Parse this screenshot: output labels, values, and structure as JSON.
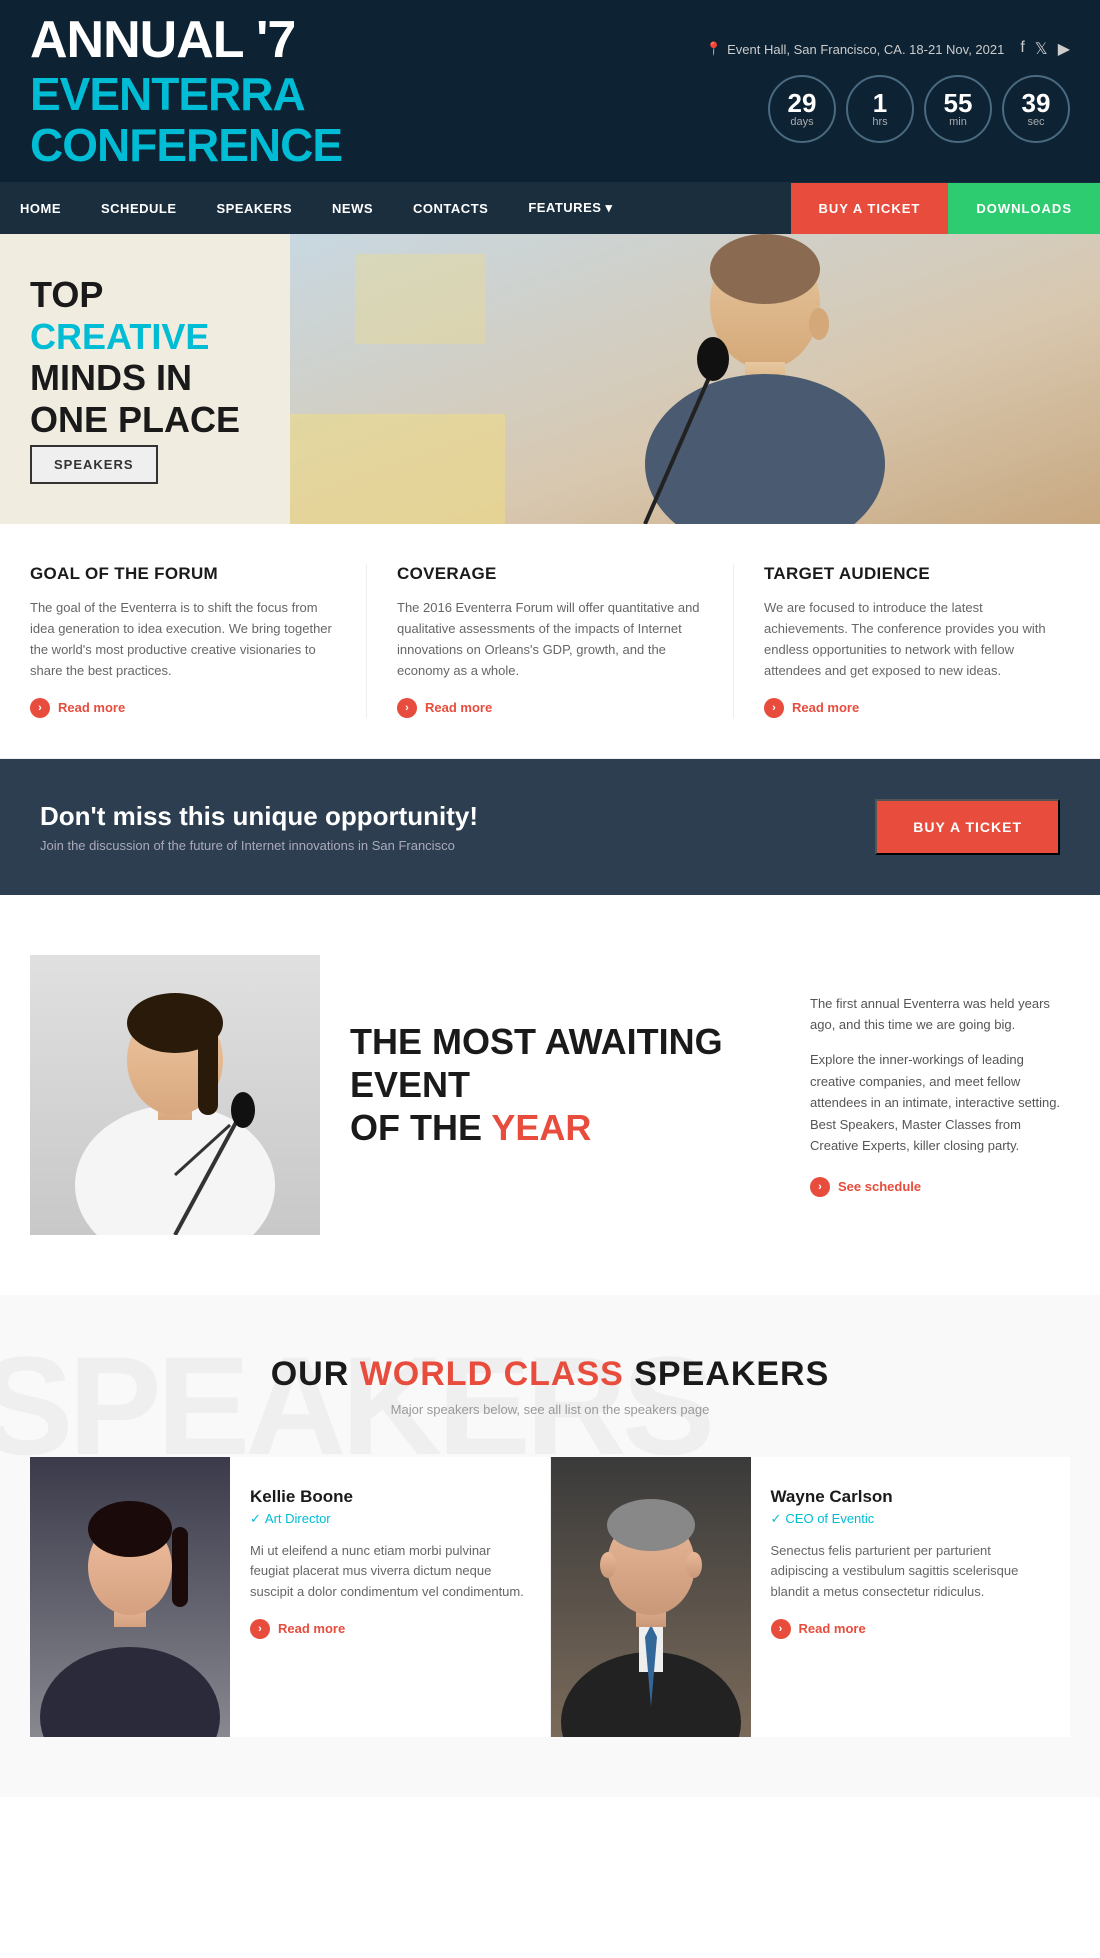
{
  "header": {
    "logo": {
      "annual": "ANNUAL '7",
      "eventerra": "EVENTERRA",
      "conference": "CONFERENCE"
    },
    "location": "Event Hall, San Francisco, CA. 18-21 Nov, 2021",
    "social": [
      "facebook",
      "twitter",
      "youtube"
    ],
    "countdown": [
      {
        "value": "29",
        "unit": "days"
      },
      {
        "value": "1",
        "unit": "hrs"
      },
      {
        "value": "55",
        "unit": "min"
      },
      {
        "value": "39",
        "unit": "sec"
      }
    ]
  },
  "nav": {
    "links": [
      "HOME",
      "SCHEDULE",
      "SPEAKERS",
      "NEWS",
      "CONTACTS",
      "FEATURES ▾"
    ],
    "btn_ticket": "BUY A TICKET",
    "btn_download": "DOWNLOADS"
  },
  "hero": {
    "title_line1": "TOP",
    "title_creative": "CREATIVE",
    "title_line2": "MINDS IN",
    "title_line3": "ONE PLACE",
    "button": "SPEAKERS"
  },
  "info": {
    "cols": [
      {
        "title": "GOAL OF THE FORUM",
        "text": "The goal of the Eventerra is to shift the focus from idea generation to idea execution. We bring together the world's most productive creative visionaries to share the best practices.",
        "read_more": "Read more"
      },
      {
        "title": "COVERAGE",
        "text": "The 2016 Eventerra Forum will offer quantitative and qualitative assessments of the impacts of Internet innovations on Orleans's GDP, growth, and the economy as a whole.",
        "read_more": "Read more"
      },
      {
        "title": "TARGET AUDIENCE",
        "text": "We are focused to introduce the latest achievements. The conference provides you with endless opportunities to network with fellow attendees and get exposed to new ideas.",
        "read_more": "Read more"
      }
    ]
  },
  "cta": {
    "headline": "Don't miss this unique opportunity!",
    "subtext": "Join the discussion of the future of Internet innovations in San Francisco",
    "button": "BUY A TICKET"
  },
  "awaiting": {
    "title_line1": "THE MOST AWAITING",
    "title_line2": "EVENT",
    "title_line3": "OF THE ",
    "title_year": "YEAR",
    "para1": "The first annual Eventerra was held years ago, and this time we are going big.",
    "para2": "Explore the inner-workings of leading creative companies, and meet fellow attendees in an intimate, interactive setting. Best Speakers, Master Classes from Creative Experts, killer closing party.",
    "see_schedule": "See schedule"
  },
  "speakers": {
    "bg_text": "SPEAKERS",
    "title_our": "OUR ",
    "title_world_class": "WORLD CLASS",
    "title_speakers": " SPEAKERS",
    "subtitle": "Major speakers below, see all list on the speakers page",
    "people": [
      {
        "name": "Kellie Boone",
        "role": "Art Director",
        "bio": "Mi ut eleifend a nunc etiam morbi pulvinar feugiat placerat mus viverra dictum neque suscipit a dolor condimentum vel condimentum.",
        "read_more": "Read more",
        "gender": "f"
      },
      {
        "name": "Wayne Carlson",
        "role": "CEO of Eventic",
        "bio": "Senectus felis parturient per parturient adipiscing a vestibulum sagittis scelerisque blandit a metus consectetur ridiculus.",
        "read_more": "Read more",
        "gender": "m"
      }
    ]
  }
}
